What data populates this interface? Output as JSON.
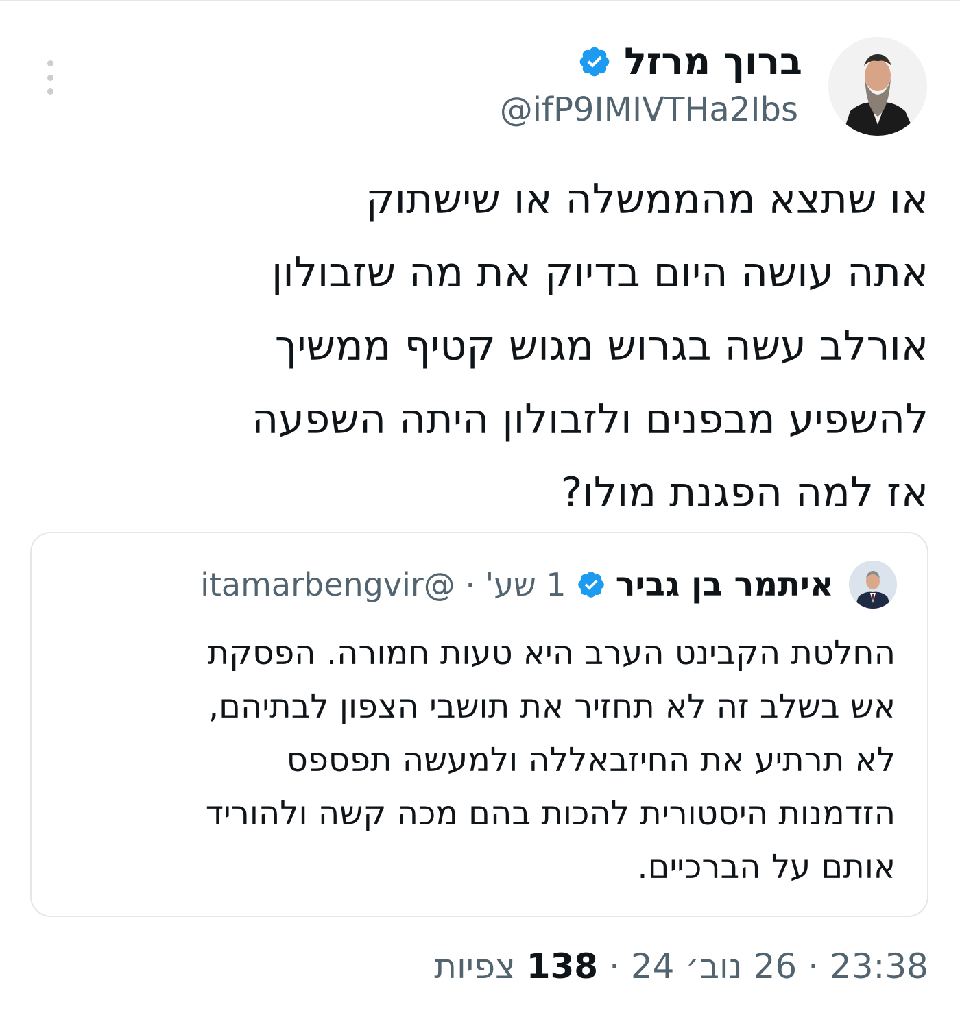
{
  "tweet": {
    "author_name": "ברוך מרזל",
    "author_handle": "@ifP9IMIVTHa2Ibs",
    "text_lines": [
      "או שתצא מהממשלה או שישתוק",
      "אתה עושה היום בדיוק את מה שזבולון",
      "אורלב עשה בגרוש מגוש קטיף ממשיך",
      "להשפיע מבפנים ולזבולון היתה השפעה",
      "אז למה הפגנת מולו?"
    ],
    "time": "23:38",
    "date": "26 נוב׳ 24",
    "views_count": "138",
    "views_label": "צפיות"
  },
  "quoted_tweet": {
    "author_name": "איתמר בן גביר",
    "author_handle": "@itamarbengvir",
    "age": "1 שע'",
    "separator": "·",
    "text_lines": [
      "החלטת הקבינט הערב היא טעות חמורה. הפסקת",
      "אש בשלב זה לא תחזיר את תושבי הצפון לבתיהם,",
      "לא תרתיע את החיזבאללה ולמעשה תפספס",
      "הזדמנות היסטורית להכות בהם מכה קשה ולהוריד",
      "אותם על הברכיים."
    ]
  },
  "icons": {
    "verified": "verified-badge-icon",
    "menu": "more-options-icon"
  },
  "colors": {
    "verified_blue": "#1d9bf0",
    "secondary_text": "#536471",
    "primary_text": "#0f1419",
    "border": "#e3e7ea"
  }
}
